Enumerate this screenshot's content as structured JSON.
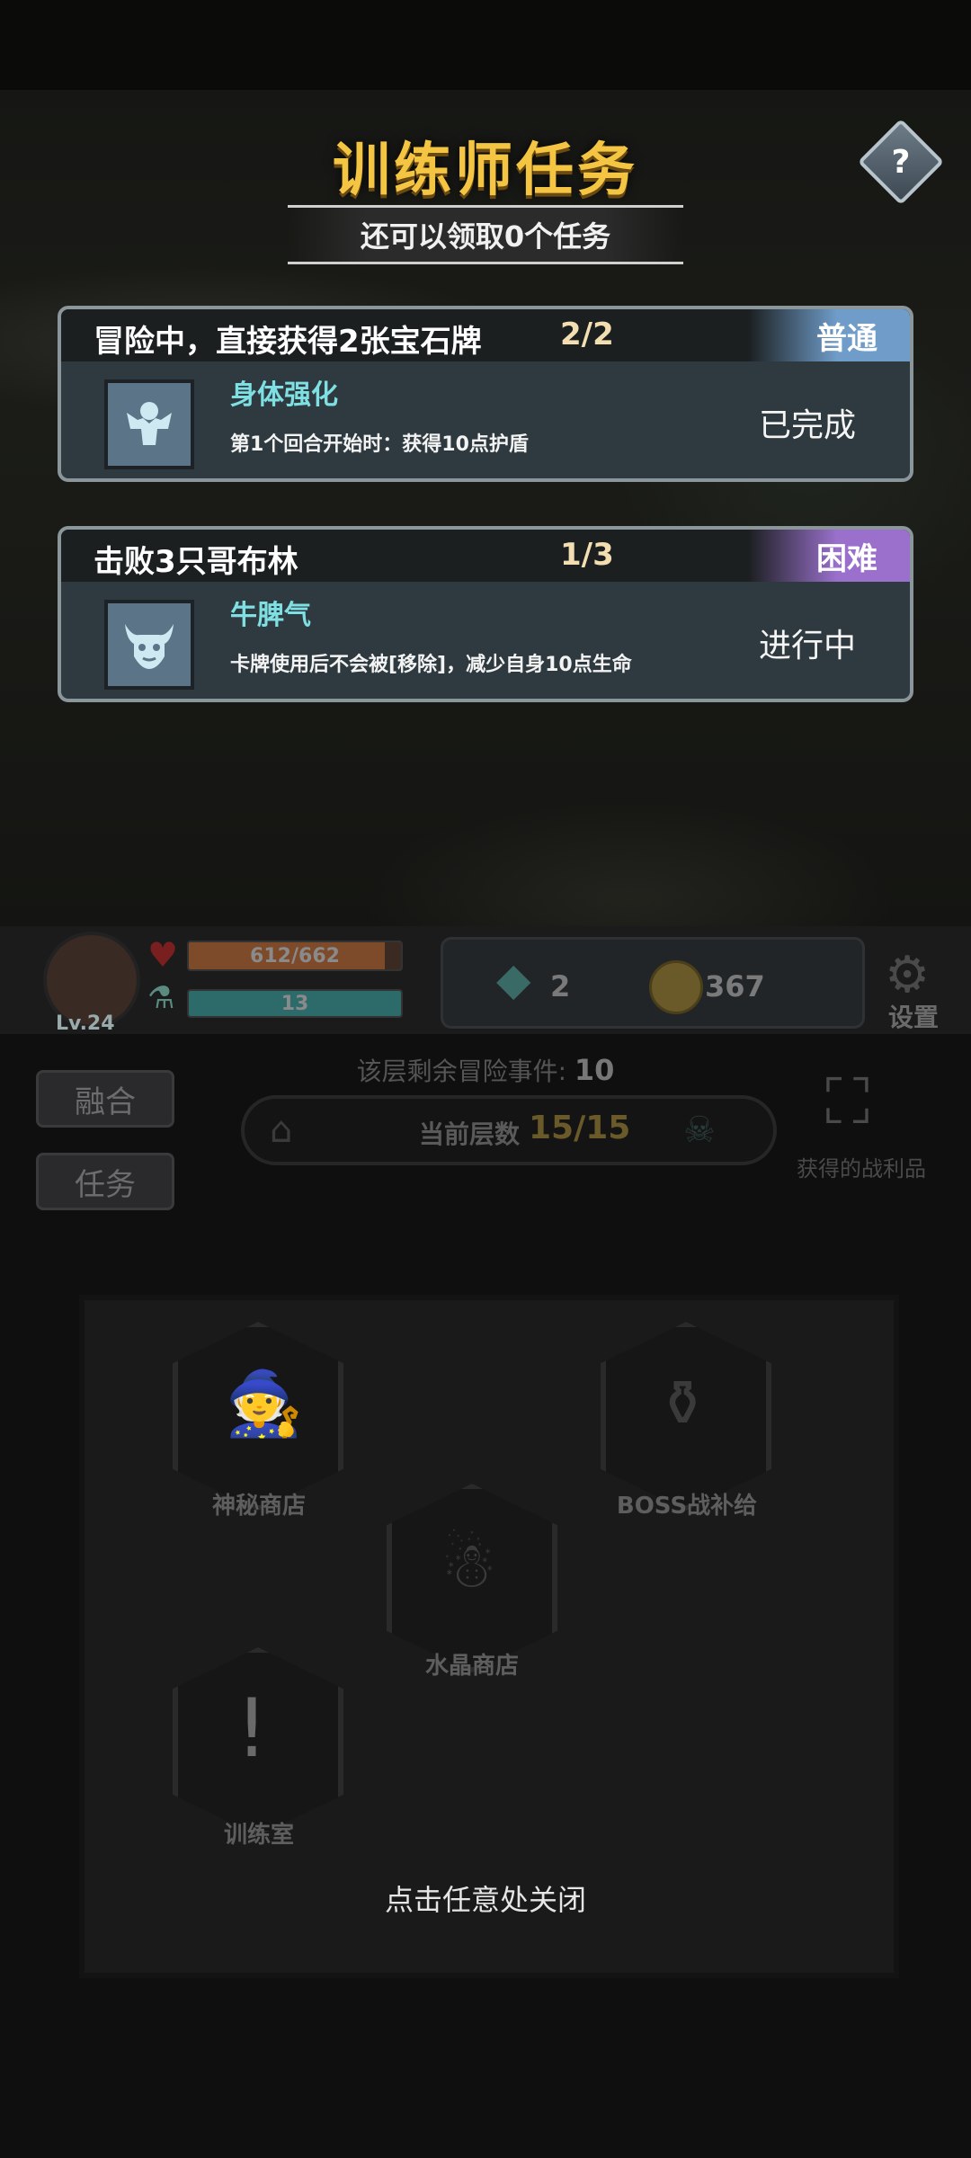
{
  "title": "训练师任务",
  "subtitle": "还可以领取0个任务",
  "help_label": "?",
  "tasks": [
    {
      "name": "冒险中，直接获得2张宝石牌",
      "progress": "2/2",
      "difficulty": "普通",
      "skill_name": "身体强化",
      "skill_desc": "第1个回合开始时：获得10点护盾",
      "status": "已完成",
      "icon": "muscle-icon"
    },
    {
      "name": "击败3只哥布林",
      "progress": "1/3",
      "difficulty": "困难",
      "skill_name": "牛脾气",
      "skill_desc": "卡牌使用后不会被[移除]，减少自身10点生命",
      "status": "进行中",
      "icon": "bull-icon"
    }
  ],
  "player": {
    "level": "Lv.24",
    "hp": "612/662",
    "hp_fraction": 0.924,
    "mp": "13",
    "mp_fraction": 1.0
  },
  "resources": {
    "gems": "2",
    "coins": "367"
  },
  "settings_label": "设置",
  "menu": {
    "fusion": "融合",
    "tasks": "任务"
  },
  "floor": {
    "events_label": "该层剩余冒险事件:",
    "events_value": "10",
    "current_label": "当前层数",
    "current_value": "15/15"
  },
  "loot_label": "获得的战利品",
  "map_nodes": {
    "mystery_shop": "神秘商店",
    "boss_supply": "BOSS战补给",
    "crystal_shop": "水晶商店",
    "training_room": "训练室"
  },
  "close_hint": "点击任意处关闭",
  "colors": {
    "title": "#f4c542",
    "normal": "#6f9cc9",
    "hard": "#9a70cc",
    "skill_name": "#7fe0e4"
  }
}
